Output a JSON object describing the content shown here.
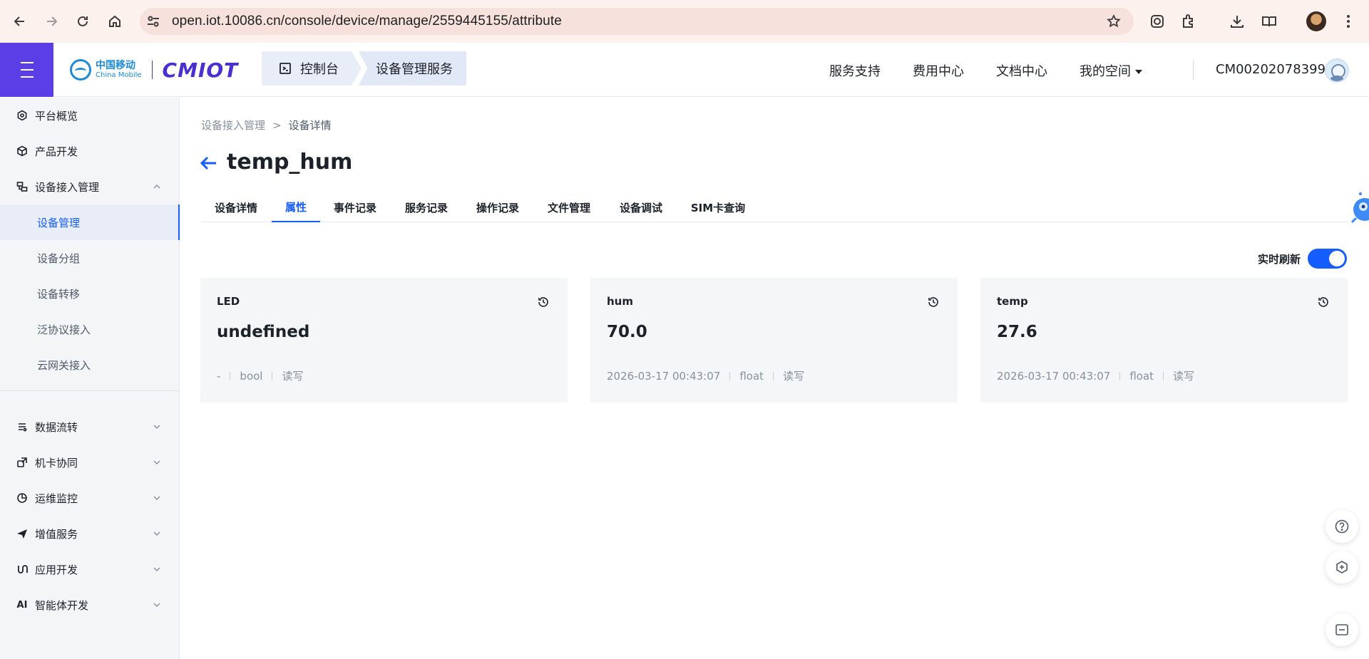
{
  "browser": {
    "url": "open.iot.10086.cn/console/device/manage/2559445155/attribute"
  },
  "header": {
    "brand_cn": "中国移动",
    "brand_en": "China Mobile",
    "brand_product": "CMIOT",
    "console_label": "控制台",
    "service_label": "设备管理服务",
    "links": [
      "服务支持",
      "费用中心",
      "文档中心"
    ],
    "my_space": "我的空间",
    "account": "CM002020783995"
  },
  "sidebar": {
    "items": [
      {
        "label": "平台概览",
        "icon": "hexagon-icon"
      },
      {
        "label": "产品开发",
        "icon": "cube-icon"
      },
      {
        "label": "设备接入管理",
        "icon": "device-access-icon"
      },
      {
        "label": "数据流转",
        "icon": "data-flow-icon"
      },
      {
        "label": "机卡协同",
        "icon": "link-icon"
      },
      {
        "label": "运维监控",
        "icon": "pie-chart-icon"
      },
      {
        "label": "增值服务",
        "icon": "send-icon"
      },
      {
        "label": "应用开发",
        "icon": "app-dev-icon"
      },
      {
        "label": "智能体开发",
        "icon": "ai-icon"
      }
    ],
    "sub_items": [
      "设备管理",
      "设备分组",
      "设备转移",
      "泛协议接入",
      "云网关接入"
    ],
    "active_sub": "设备管理"
  },
  "breadcrumb": {
    "parent": "设备接入管理",
    "separator": ">",
    "current": "设备详情"
  },
  "page": {
    "title": "temp_hum"
  },
  "tabs": [
    "设备详情",
    "属性",
    "事件记录",
    "服务记录",
    "操作记录",
    "文件管理",
    "设备调试",
    "SIM卡查询"
  ],
  "active_tab": "属性",
  "realtime_refresh": {
    "label": "实时刷新",
    "enabled": true
  },
  "attributes": [
    {
      "name": "LED",
      "value": "undefined",
      "time": "-",
      "type": "bool",
      "access": "读写"
    },
    {
      "name": "hum",
      "value": "70.0",
      "time": "2026-03-17 00:43:07",
      "type": "float",
      "access": "读写"
    },
    {
      "name": "temp",
      "value": "27.6",
      "time": "2026-03-17 00:43:07",
      "type": "float",
      "access": "读写"
    }
  ],
  "colors": {
    "accent": "#165dff",
    "brand_purple": "#5b3ee6"
  }
}
